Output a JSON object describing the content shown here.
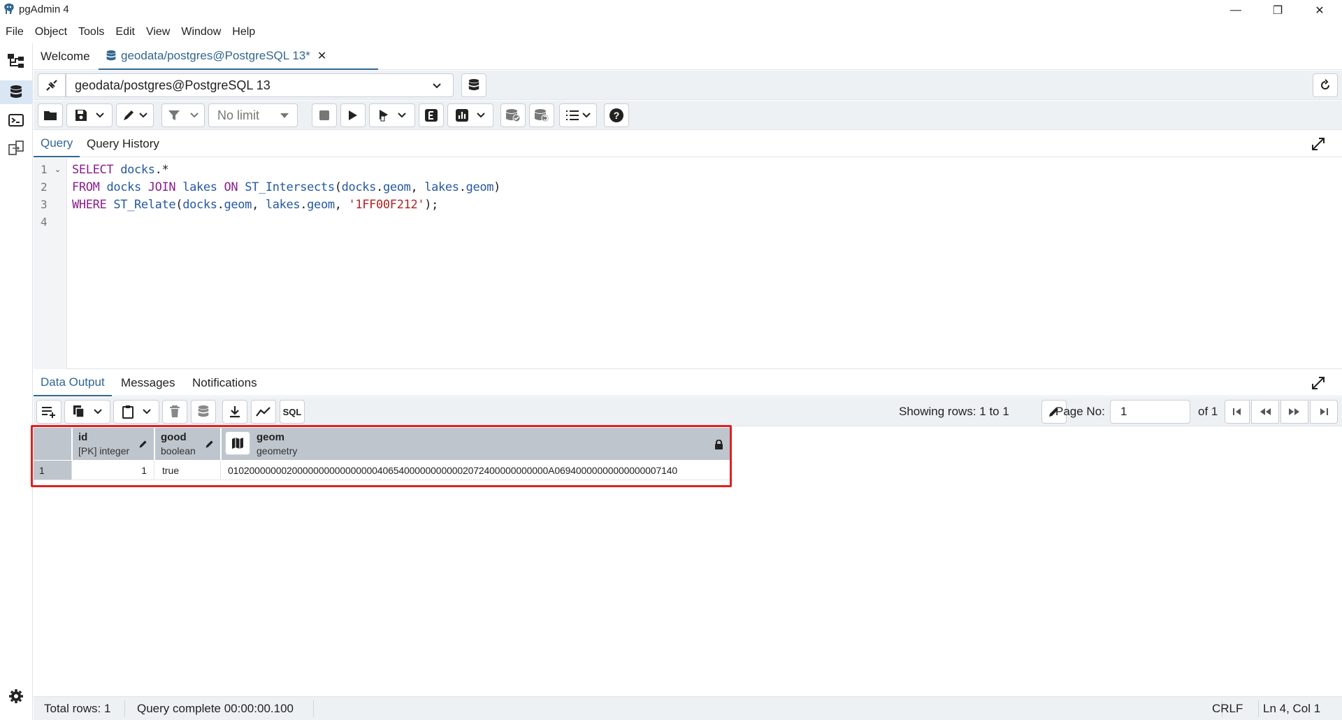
{
  "window": {
    "title": "pgAdmin 4",
    "controls": {
      "minimize": "—",
      "restore": "❐",
      "close": "✕"
    }
  },
  "menu": [
    "File",
    "Object",
    "Tools",
    "Edit",
    "View",
    "Window",
    "Help"
  ],
  "tabs": [
    {
      "label": "Welcome"
    },
    {
      "label": "geodata/postgres@PostgreSQL 13*",
      "close": "✕"
    }
  ],
  "connection": {
    "selected": "geodata/postgres@PostgreSQL 13"
  },
  "toolbar": {
    "limit": "No limit"
  },
  "query_tabs": [
    "Query",
    "Query History"
  ],
  "editor": {
    "line_numbers": [
      "1",
      "2",
      "3",
      "4"
    ]
  },
  "output_tabs": [
    "Data Output",
    "Messages",
    "Notifications"
  ],
  "pagination": {
    "showing": "Showing rows: 1 to 1",
    "page_label": "Page No:",
    "page_value": "1",
    "of": "of 1"
  },
  "grid": {
    "columns": [
      {
        "name": "id",
        "type": "[PK] integer"
      },
      {
        "name": "good",
        "type": "boolean"
      },
      {
        "name": "geom",
        "type": "geometry"
      }
    ],
    "rows": [
      {
        "rownum": "1",
        "id": "1",
        "good": "true",
        "geom": "010200000002000000000000000040654000000000002072400000000000A06940000000000000007140"
      }
    ]
  },
  "status": {
    "total_rows": "Total rows: 1",
    "query_complete": "Query complete 00:00:00.100",
    "eol": "CRLF",
    "position": "Ln 4, Col 1"
  },
  "colors": {
    "accent": "#326690",
    "highlight": "#e02020",
    "keyword": "#8a1f8a",
    "identifier": "#2558a3",
    "string": "#b22222"
  }
}
